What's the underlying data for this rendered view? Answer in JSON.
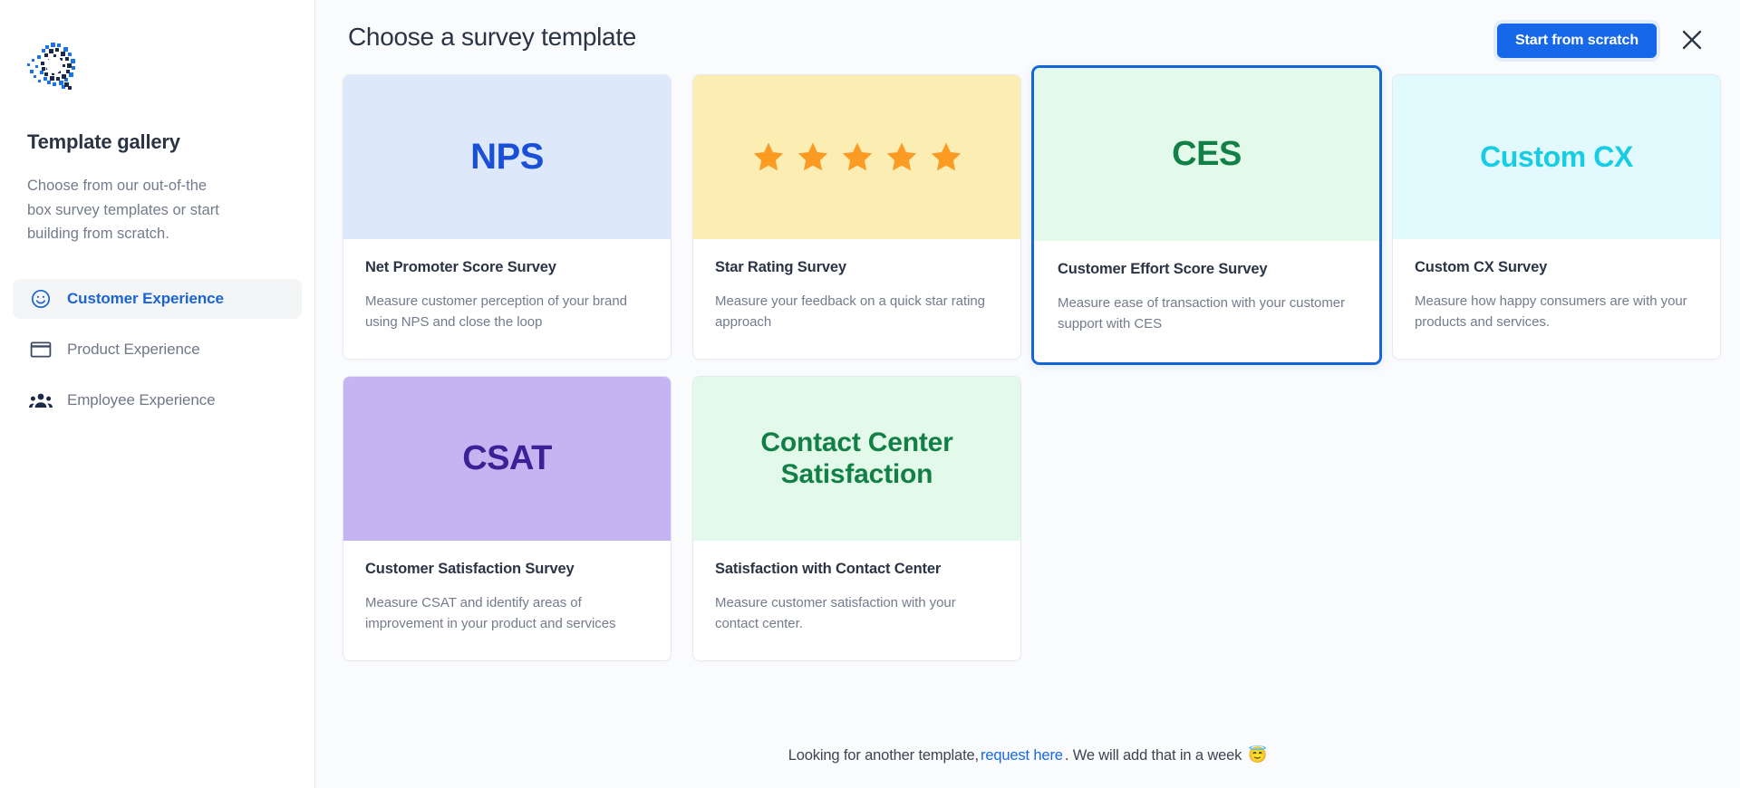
{
  "sidebar": {
    "logo_icon": "quantum-q-logo",
    "title": "Template gallery",
    "description": "Choose from our out-of-the box survey templates or start building from scratch.",
    "items": [
      {
        "label": "Customer Experience",
        "icon": "smiley-face-icon",
        "active": true
      },
      {
        "label": "Product Experience",
        "icon": "window-rectangle-icon",
        "active": false
      },
      {
        "label": "Employee Experience",
        "icon": "people-group-icon",
        "active": false
      }
    ]
  },
  "header": {
    "title": "Choose a survey template",
    "start_from_scratch_label": "Start from scratch",
    "close_icon": "close-icon"
  },
  "templates": [
    {
      "banner_label": "NPS",
      "banner_kind": "text",
      "banner_bg": "#dde8fb",
      "banner_color": "#1a50d8",
      "title": "Net Promoter Score Survey",
      "description": "Measure customer perception of your brand using NPS and close the loop",
      "selected": false
    },
    {
      "banner_label": "",
      "banner_kind": "stars",
      "star_count": 5,
      "banner_bg": "#fcedb3",
      "banner_color": "#fb9b23",
      "title": "Star Rating Survey",
      "description": "Measure your feedback on a quick star rating approach",
      "selected": false
    },
    {
      "banner_label": "CES",
      "banner_kind": "text",
      "banner_bg": "#e3f9ea",
      "banner_color": "#128046",
      "title": "Customer Effort Score Survey",
      "description": "Measure ease of transaction with your customer support with CES",
      "selected": true
    },
    {
      "banner_label": "Custom CX",
      "banner_kind": "text",
      "banner_bg": "#e2f9fd",
      "banner_color": "#16cde4",
      "title": "Custom CX Survey",
      "description": "Measure how happy consumers are with your products and services.",
      "selected": false
    },
    {
      "banner_label": "CSAT",
      "banner_kind": "text",
      "banner_bg": "#c4b5f2",
      "banner_color": "#3b2196",
      "title": "Customer Satisfaction Survey",
      "description": "Measure CSAT and identify areas of improvement in your product and services",
      "selected": false
    },
    {
      "banner_label": "Contact Center Satisfaction",
      "banner_kind": "text",
      "banner_bg": "#e3f9ea",
      "banner_color": "#128046",
      "title": "Satisfaction with Contact Center",
      "description": "Measure customer satisfaction with your contact center.",
      "selected": false
    }
  ],
  "footer": {
    "text_before": "Looking for another template,",
    "link_label": "request here",
    "text_after": ". We will add that in a week",
    "emoji": "😇"
  },
  "colors": {
    "accent": "#1768e8",
    "selected_border": "#1565d8",
    "main_bg": "#fafbfc",
    "sidebar_bg": "#ffffff",
    "text_primary": "#2b3445",
    "text_muted": "#737b8c"
  }
}
